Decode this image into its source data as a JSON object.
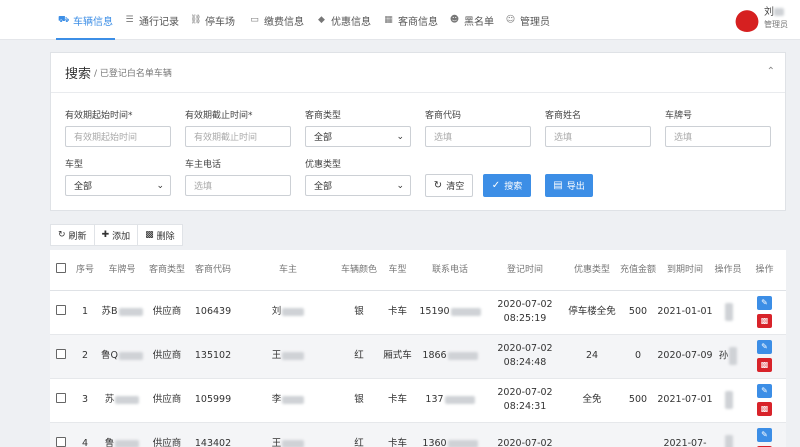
{
  "nav": {
    "items": [
      {
        "label": "车辆信息",
        "icon": "truck-icon",
        "active": true
      },
      {
        "label": "通行记录",
        "icon": "list-icon",
        "active": false
      },
      {
        "label": "停车场",
        "icon": "car-icon",
        "active": false
      },
      {
        "label": "缴费信息",
        "icon": "card-icon",
        "active": false
      },
      {
        "label": "优惠信息",
        "icon": "tag-icon",
        "active": false
      },
      {
        "label": "客商信息",
        "icon": "id-card-icon",
        "active": false
      },
      {
        "label": "黑名单",
        "icon": "user-x-icon",
        "active": false
      },
      {
        "label": "管理员",
        "icon": "users-icon",
        "active": false
      }
    ],
    "user_name": "刘",
    "user_role": "管理员"
  },
  "search": {
    "title": "搜索",
    "subtitle": "/ 已登记白名单车辆",
    "fields": [
      {
        "label": "有效期起始时间*",
        "placeholder": "有效期起始时间"
      },
      {
        "label": "有效期截止时间*",
        "placeholder": "有效期截止时间"
      },
      {
        "label": "客商类型",
        "value": "全部"
      },
      {
        "label": "客商代码",
        "placeholder": "选填"
      },
      {
        "label": "客商姓名",
        "placeholder": "选填"
      },
      {
        "label": "车牌号",
        "placeholder": "选填"
      },
      {
        "label": "车型",
        "value": "全部"
      },
      {
        "label": "车主电话",
        "placeholder": "选填"
      },
      {
        "label": "优惠类型",
        "value": "全部"
      }
    ],
    "clear_label": "清空",
    "search_label": "搜索",
    "export_label": "导出"
  },
  "toolbar": {
    "refresh_label": "刷新",
    "add_label": "添加",
    "delete_label": "删除"
  },
  "table": {
    "headers": [
      "序号",
      "车牌号",
      "客商类型",
      "客商代码",
      "车主",
      "车辆颜色",
      "车型",
      "联系电话",
      "登记时间",
      "优惠类型",
      "充值金额",
      "到期时间",
      "操作员",
      "操作"
    ],
    "rows": [
      {
        "no": "1",
        "plate": "苏B",
        "merchant_type": "供应商",
        "merchant_code": "106439",
        "owner": "刘",
        "color": "银",
        "vehicle_type": "卡车",
        "phone": "15190",
        "reg_time": "2020-07-02 08:25:19",
        "discount": "停车楼全免",
        "amount": "500",
        "expire": "2021-01-01",
        "operator": ""
      },
      {
        "no": "2",
        "plate": "鲁Q",
        "merchant_type": "供应商",
        "merchant_code": "135102",
        "owner": "王",
        "color": "红",
        "vehicle_type": "厢式车",
        "phone": "1866",
        "reg_time": "2020-07-02 08:24:48",
        "discount": "24",
        "amount": "0",
        "expire": "2020-07-09",
        "operator": "孙"
      },
      {
        "no": "3",
        "plate": "苏",
        "merchant_type": "供应商",
        "merchant_code": "105999",
        "owner": "李",
        "color": "银",
        "vehicle_type": "卡车",
        "phone": "137",
        "reg_time": "2020-07-02 08:24:31",
        "discount": "全免",
        "amount": "500",
        "expire": "2021-07-01",
        "operator": ""
      },
      {
        "no": "4",
        "plate": "鲁",
        "merchant_type": "供应商",
        "merchant_code": "143402",
        "owner": "王",
        "color": "红",
        "vehicle_type": "卡车",
        "phone": "1360",
        "reg_time": "2020-07-02",
        "discount": "",
        "amount": "",
        "expire": "2021-07-",
        "operator": ""
      }
    ]
  }
}
